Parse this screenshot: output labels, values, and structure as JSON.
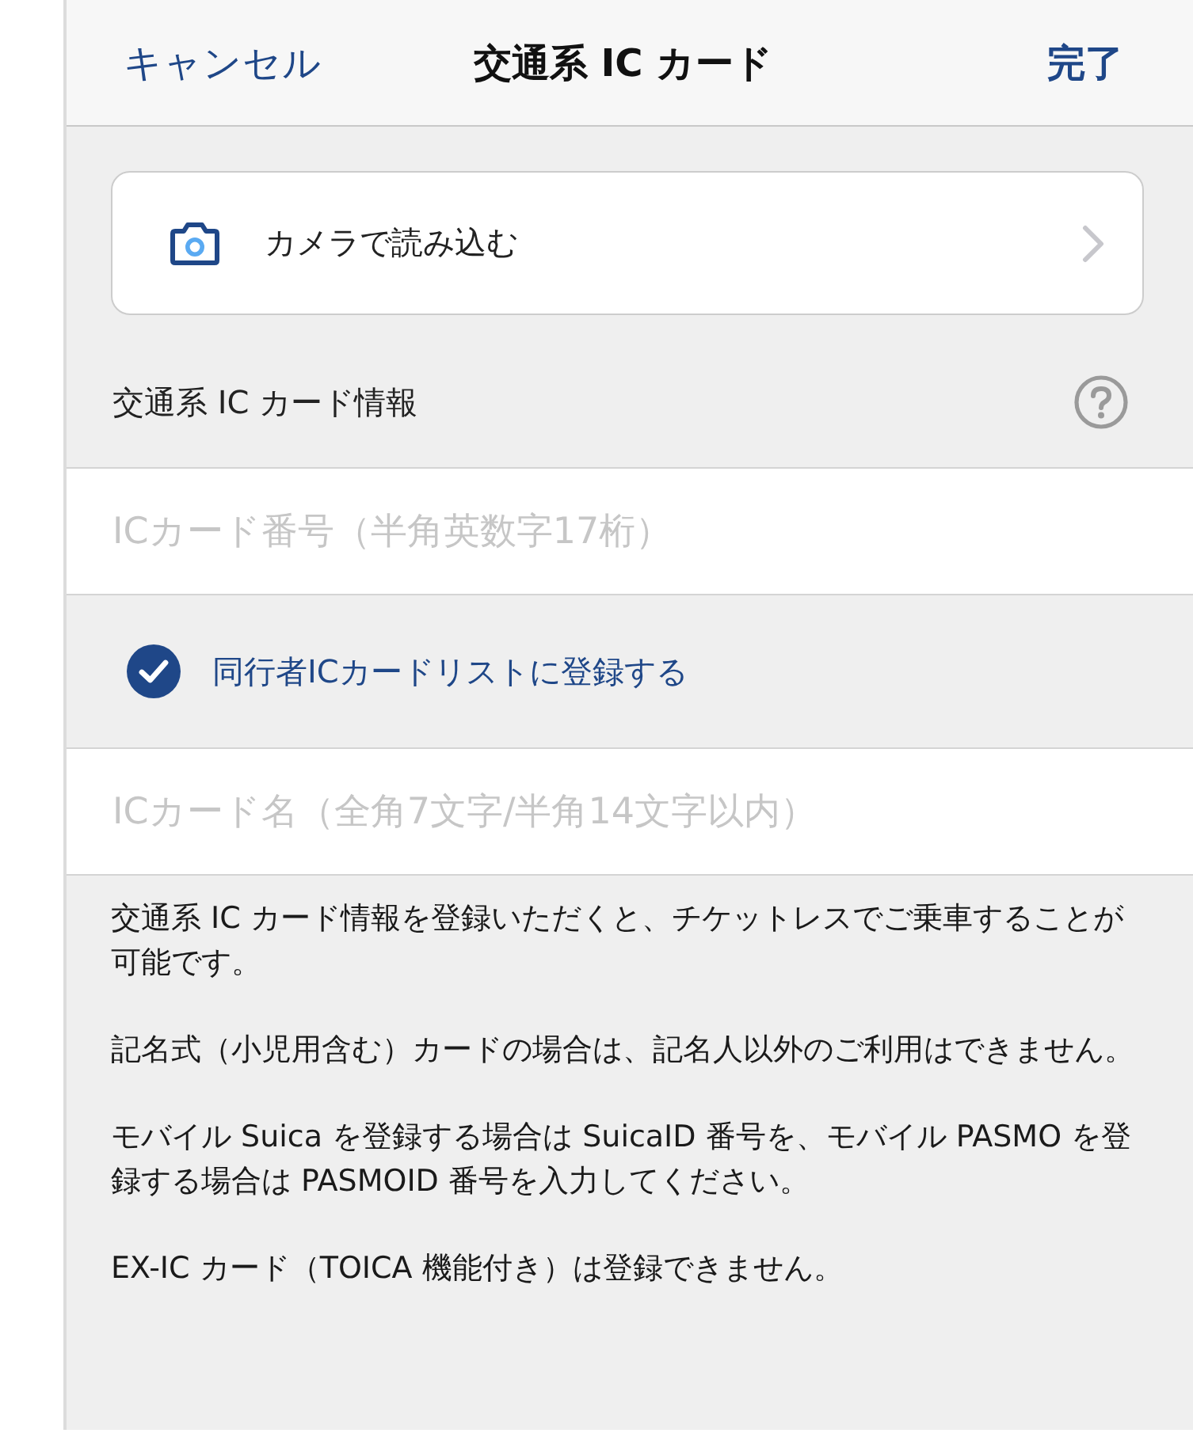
{
  "nav_bar": {
    "cancel": "キャンセル",
    "title": "交通系 IC カード",
    "done": "完了"
  },
  "camera_button": {
    "label": "カメラで読み込む"
  },
  "section": {
    "title": "交通系 IC カード情報"
  },
  "form_rows": [
    {
      "kind": "input",
      "placeholder": "ICカード番号（半角英数字17桁）"
    },
    {
      "kind": "checkbox",
      "label": "同行者ICカードリストに登録する",
      "checked": true
    },
    {
      "kind": "input",
      "placeholder": "ICカード名（全角7文字/半角14文字以内）"
    }
  ],
  "notes": [
    "交通系 IC カード情報を登録いただくと、チケットレスでご乗車することが可能です。",
    "記名式（小児用含む）カードの場合は、記名人以外のご利用はできません。",
    "モバイル Suica を登録する場合は SuicaID 番号を、モバイル PASMO を登録する場合は PASMOID 番号を入力してください。",
    "EX-IC カード（TOICA 機能付き）は登録できません。"
  ]
}
